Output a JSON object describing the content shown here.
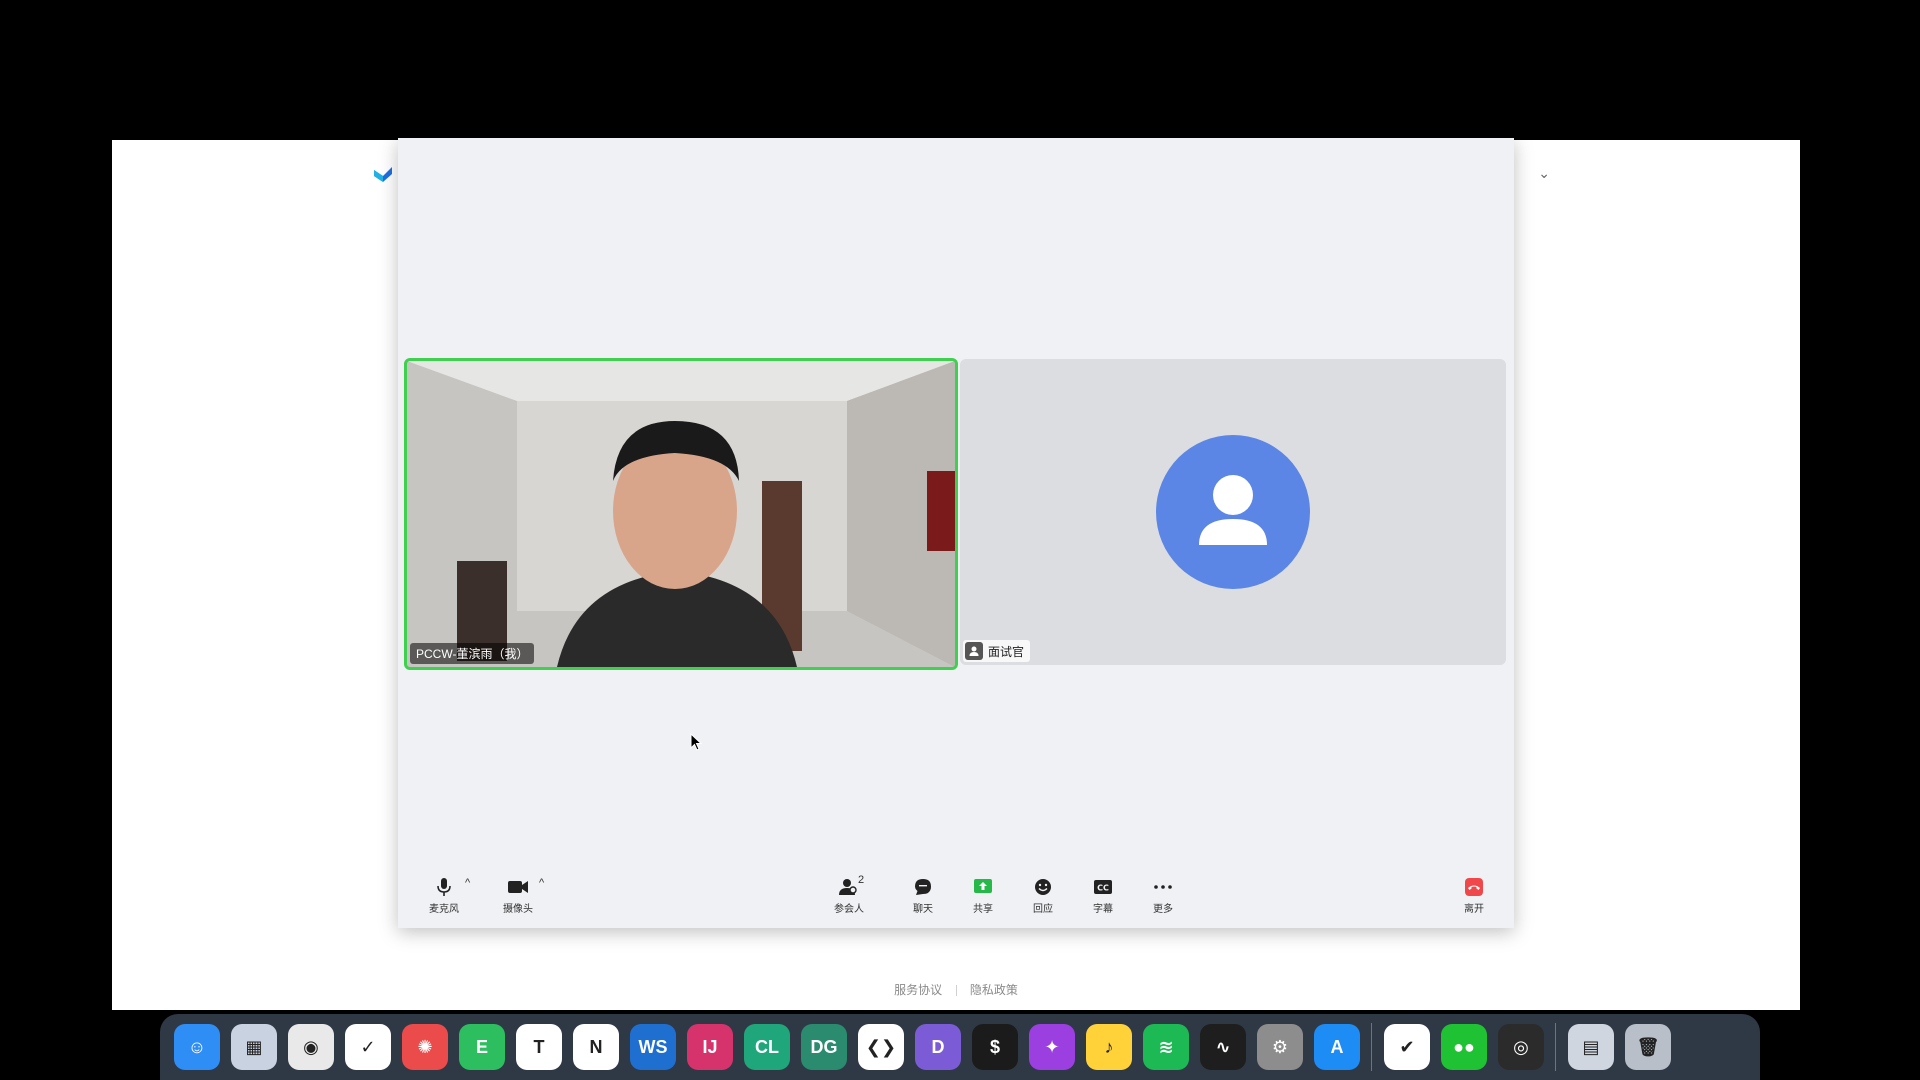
{
  "background_window": {
    "footer_links": [
      "服务协议",
      "隐私政策"
    ]
  },
  "meeting": {
    "self_tile": {
      "name": "PCCW-董滨雨（我）"
    },
    "other_tile": {
      "name": "面试官"
    }
  },
  "toolbar": {
    "mic": {
      "label": "麦克风",
      "icon": "microphone-icon"
    },
    "camera": {
      "label": "摄像头",
      "icon": "camera-icon"
    },
    "participants": {
      "label": "参会人",
      "count": "2",
      "icon": "participants-icon"
    },
    "chat": {
      "label": "聊天",
      "icon": "chat-icon"
    },
    "share": {
      "label": "共享",
      "icon": "share-screen-icon"
    },
    "reactions": {
      "label": "回应",
      "icon": "reaction-icon"
    },
    "captions": {
      "label": "字幕",
      "icon": "captions-icon"
    },
    "more": {
      "label": "更多",
      "icon": "more-icon"
    },
    "leave": {
      "label": "离开",
      "icon": "leave-icon"
    }
  },
  "dock": {
    "apps": [
      {
        "name": "finder",
        "color": "#2f8ef5",
        "glyph": "☺"
      },
      {
        "name": "launchpad",
        "color": "#c9d2e0",
        "glyph": "▦"
      },
      {
        "name": "chrome",
        "color": "#e9e9e9",
        "glyph": "◉"
      },
      {
        "name": "ticktick",
        "color": "#ffffff",
        "glyph": "✓"
      },
      {
        "name": "toolbox",
        "color": "#ec4b4b",
        "glyph": "✺"
      },
      {
        "name": "evernote",
        "color": "#2dbe60",
        "glyph": "E"
      },
      {
        "name": "typora",
        "color": "#ffffff",
        "glyph": "T"
      },
      {
        "name": "notion",
        "color": "#ffffff",
        "glyph": "N"
      },
      {
        "name": "webstorm",
        "color": "#1f6fd1",
        "glyph": "WS"
      },
      {
        "name": "intellij",
        "color": "#d6336c",
        "glyph": "IJ"
      },
      {
        "name": "clion",
        "color": "#1fa67a",
        "glyph": "CL"
      },
      {
        "name": "datagrip",
        "color": "#2a8b6f",
        "glyph": "DG"
      },
      {
        "name": "vscode",
        "color": "#ffffff",
        "glyph": "❮❯"
      },
      {
        "name": "dash",
        "color": "#7b5cd6",
        "glyph": "D"
      },
      {
        "name": "terminal",
        "color": "#1b1b1b",
        "glyph": "$"
      },
      {
        "name": "shortcuts",
        "color": "#9b3fe0",
        "glyph": "✦"
      },
      {
        "name": "music-app",
        "color": "#ffd23a",
        "glyph": "♪"
      },
      {
        "name": "spotify",
        "color": "#1db954",
        "glyph": "≋"
      },
      {
        "name": "activity-monitor",
        "color": "#1e1e1e",
        "glyph": "∿"
      },
      {
        "name": "system-settings",
        "color": "#8d8d8d",
        "glyph": "⚙"
      },
      {
        "name": "app-store",
        "color": "#1e8cf5",
        "glyph": "A"
      },
      {
        "name": "sep"
      },
      {
        "name": "meeting-app",
        "color": "#ffffff",
        "glyph": "✔"
      },
      {
        "name": "wechat",
        "color": "#1fc233",
        "glyph": "●●"
      },
      {
        "name": "obs",
        "color": "#2b2b2b",
        "glyph": "◎"
      },
      {
        "name": "sep"
      },
      {
        "name": "downloads",
        "color": "#cfd6e0",
        "glyph": "▤"
      },
      {
        "name": "trash",
        "color": "#b8bfc8",
        "glyph": "🗑"
      }
    ]
  }
}
